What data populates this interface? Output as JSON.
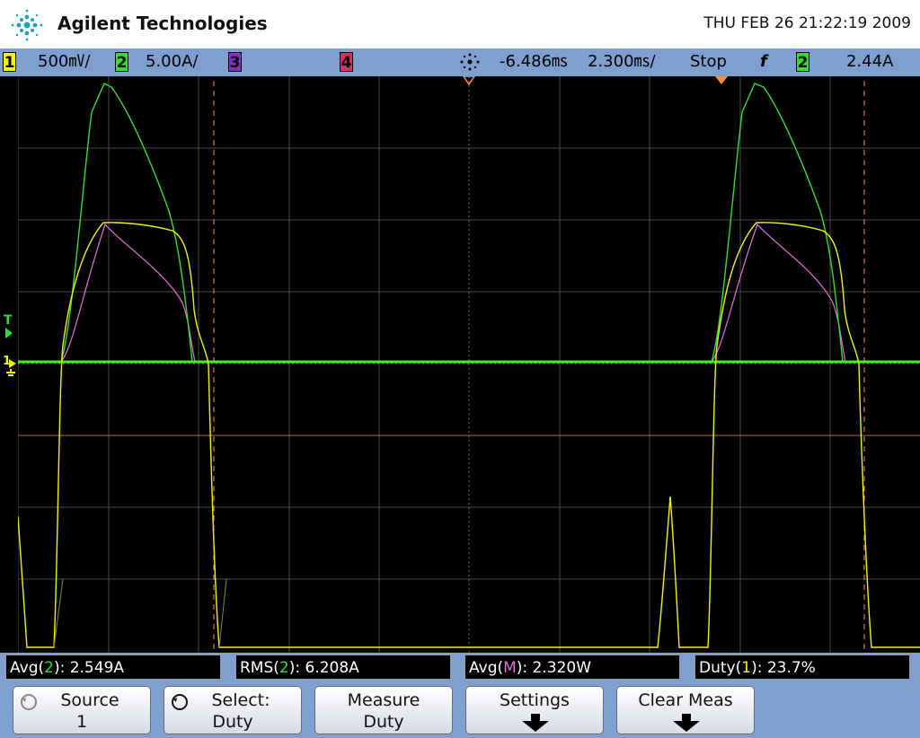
{
  "header": {
    "brand": "Agilent Technologies",
    "datetime": "THU FEB 26 21:22:19 2009"
  },
  "status": {
    "ch1_label": "1",
    "ch1_scale": "500㎷/",
    "ch2_label": "2",
    "ch2_scale": "5.00A/",
    "ch3_label": "3",
    "ch4_label": "4",
    "time_delay": "-6.486㎳",
    "time_scale": "2.300㎳/",
    "run_state": "Stop",
    "trigger_slope": "f",
    "trigger_source": "2",
    "trigger_level": "2.44A"
  },
  "channel_colors": {
    "ch1": "#f4f400",
    "ch2": "#33dd33",
    "math": "#e070e0",
    "cursor": "#ff8c40"
  },
  "measurements": [
    {
      "prefix": "Avg(",
      "src": "2",
      "suffix": "): 2.549A"
    },
    {
      "prefix": "RMS(",
      "src": "2",
      "suffix": "): 6.208A"
    },
    {
      "prefix": "Avg(",
      "src": "M",
      "suffix": "): 2.320W"
    },
    {
      "prefix": "Duty(",
      "src": "1",
      "suffix": "): 23.7%"
    }
  ],
  "softkeys": {
    "source": {
      "line1": "Source",
      "line2": "1"
    },
    "select": {
      "line1": "Select:",
      "line2": "Duty"
    },
    "measure": {
      "line1": "Measure",
      "line2": "Duty"
    },
    "settings": {
      "line1": "Settings"
    },
    "clear": {
      "line1": "Clear Meas"
    }
  },
  "markers": {
    "trigger_marker": "T",
    "ground_marker": "1"
  }
}
